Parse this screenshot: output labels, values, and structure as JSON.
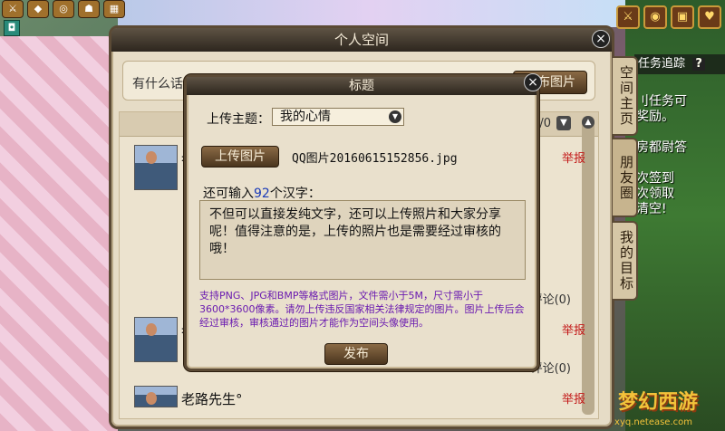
{
  "top_icons": [
    "⚔",
    "◆",
    "◎",
    "☗",
    "▦"
  ],
  "small_square": "◘",
  "right_icons": [
    "⚔",
    "◉",
    "▣",
    "♥"
  ],
  "task_tracker": {
    "label": "任务追踪",
    "help": "?"
  },
  "task_text": [
    "刂任务可",
    "奖励。",
    "",
    "房都尉答",
    "",
    "次签到",
    "次领取",
    "清空!"
  ],
  "panel": {
    "title": "个人空间",
    "close": "×",
    "compose_placeholder": "有什么话想跟大家说？",
    "publish_image_button": "发布图片",
    "feed_count": "/0",
    "posts": [
      {
        "author": "老",
        "report": "举报",
        "comments": "评论(0)"
      },
      {
        "author": "老",
        "report": "举报",
        "comments": "评论(0)"
      },
      {
        "author": "老路先生°",
        "report": "举报",
        "comments": ""
      }
    ]
  },
  "side_tabs": [
    "空间主页",
    "朋友圈",
    "我的目标"
  ],
  "dialog": {
    "title": "标题",
    "close": "×",
    "topic_label": "上传主题：",
    "topic_value": "我的心情",
    "upload_button": "上传图片",
    "file_name": "QQ图片20160615152856.jpg",
    "remaining_prefix": "还可输入",
    "remaining_number": "92",
    "remaining_suffix": "个汉字：",
    "text_content": "不但可以直接发纯文字，还可以上传照片和大家分享呢！值得注意的是，上传的照片也是需要经过审核的哦！",
    "hint": "支持PNG、JPG和BMP等格式图片，文件需小于5M，尺寸需小于3600*3600像素。请勿上传违反国家相关法律规定的图片。图片上传后会经过审核，审核通过的图片才能作为空间头像使用。",
    "publish_button": "发布"
  },
  "watermark": {
    "text": "梦幻西游",
    "url": "xyq.netease.com"
  }
}
